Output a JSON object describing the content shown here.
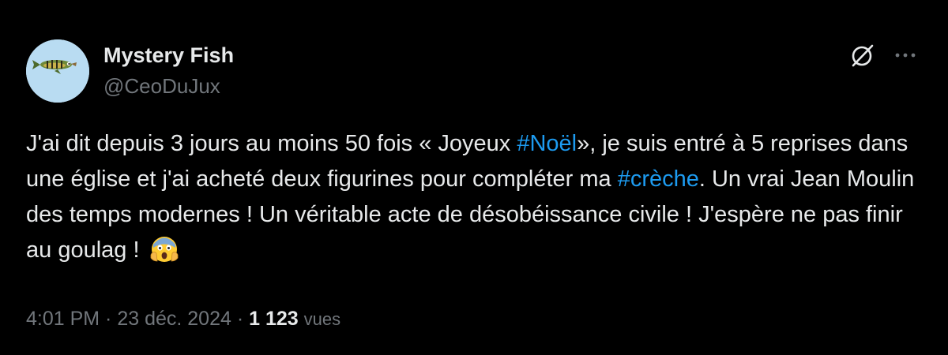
{
  "author": {
    "display_name": "Mystery Fish",
    "handle": "@CeoDuJux",
    "avatar_icon": "fish-avatar"
  },
  "actions": {
    "grok_icon": "grok-icon",
    "more_icon": "more-horizontal-icon"
  },
  "tweet": {
    "segments": [
      {
        "text": "J'ai dit depuis 3 jours au moins 50 fois « Joyeux ",
        "type": "text"
      },
      {
        "text": "#Noël",
        "type": "hashtag"
      },
      {
        "text": "», je suis entré à 5 reprises dans une église et j'ai acheté deux figurines pour compléter ma ",
        "type": "text"
      },
      {
        "text": "#crèche",
        "type": "hashtag"
      },
      {
        "text": ". Un vrai Jean Moulin des temps modernes ! Un véritable acte de désobéissance civile ! J'espère ne pas finir au goulag ! ",
        "type": "text"
      }
    ],
    "emoji": "screaming-face-emoji"
  },
  "meta": {
    "time": "4:01 PM",
    "separator": " · ",
    "date": "23 déc. 2024",
    "views_count": "1 123",
    "views_label": "vues"
  },
  "colors": {
    "background": "#000000",
    "text": "#e7e9ea",
    "muted": "#71767b",
    "link": "#1d9bf0",
    "avatar_bg": "#b9dcf2"
  }
}
